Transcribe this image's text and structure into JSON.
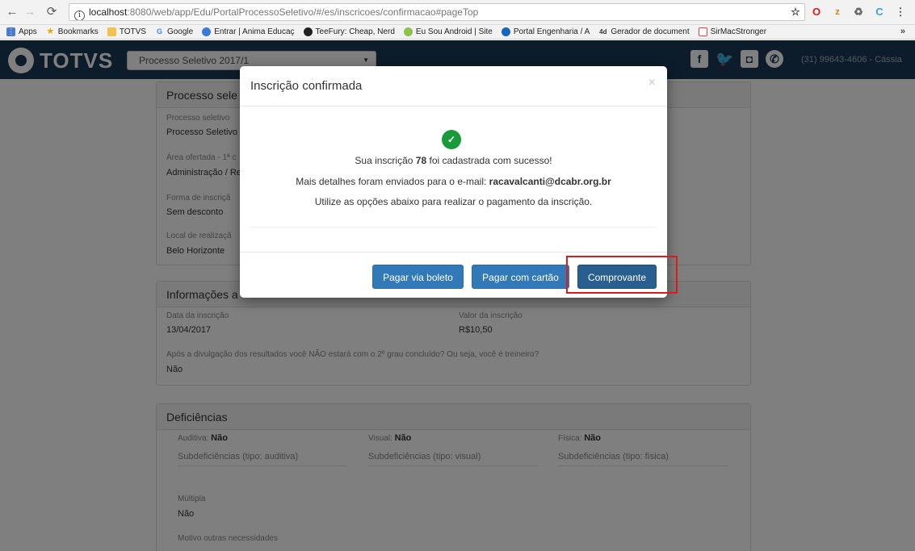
{
  "browser": {
    "url_host": "localhost",
    "url_path": ":8080/web/app/Edu/PortalProcessoSeletivo/#/es/inscricoes/confirmacao#pageTop",
    "bookmarks": [
      "Apps",
      "Bookmarks",
      "TOTVS",
      "Google",
      "Entrar | Anima Educaç",
      "TeeFury: Cheap, Nerd",
      "Eu Sou Android | Site",
      "Portal Engenharia / A",
      "Gerador de document",
      "SirMacStronger"
    ],
    "more": "»"
  },
  "header": {
    "logo": "TOTVS",
    "selected_process": "Processo Seletivo 2017/1",
    "phone": "(31) 99643-4606 - Cássia"
  },
  "panel1": {
    "title": "Processo sele",
    "fields": [
      {
        "label": "Processo seletivo",
        "value": "Processo Seletivo"
      },
      {
        "label": "Área ofertada - 1ª c",
        "value": "Administração / Re"
      },
      {
        "label": "Forma de inscriçã",
        "value": "Sem desconto"
      },
      {
        "label": "Local de realizaçã",
        "value": "Belo Horizonte"
      }
    ]
  },
  "panel2": {
    "title": "Informações a",
    "date_label": "Data da inscrição",
    "date_value": "13/04/2017",
    "fee_label": "Valor da inscrição",
    "fee_value": "R$10,50",
    "question_label": "Após a divulgação dos resultados você NÃO estará com o 2º grau concluído? Ou seja, você é treineiro?",
    "question_value": "Não"
  },
  "panel3": {
    "title": "Deficiências",
    "auditiva_label": "Auditiva:",
    "auditiva_value": "Não",
    "visual_label": "Visual:",
    "visual_value": "Não",
    "fisica_label": "Física:",
    "fisica_value": "Não",
    "sub_auditiva": "Subdeficiências (tipo: auditiva)",
    "sub_visual": "Subdeficiências (tipo: visual)",
    "sub_fisica": "Subdeficiências (tipo: física)",
    "multipla_label": "Múltipla",
    "multipla_value": "Não",
    "motivo_label": "Motivo outras necessidades"
  },
  "modal": {
    "title": "Inscrição confirmada",
    "close": "×",
    "line1_prefix": "Sua inscrição",
    "number": "78",
    "line1_suffix": "foi cadastrada com sucesso!",
    "line2_prefix": "Mais detalhes foram enviados para o e-mail:",
    "email": "racavalcanti@dcabr.org.br",
    "line3": "Utilize as opções abaixo para realizar o pagamento da inscrição.",
    "btn_boleto": "Pagar via boleto",
    "btn_cartao": "Pagar com cartão",
    "btn_comprovante": "Comprovante"
  },
  "colors": {
    "header_bg": "#1b3954",
    "primary_button": "#3279b7",
    "success": "#1a9b3b",
    "highlight": "#e0191b"
  }
}
